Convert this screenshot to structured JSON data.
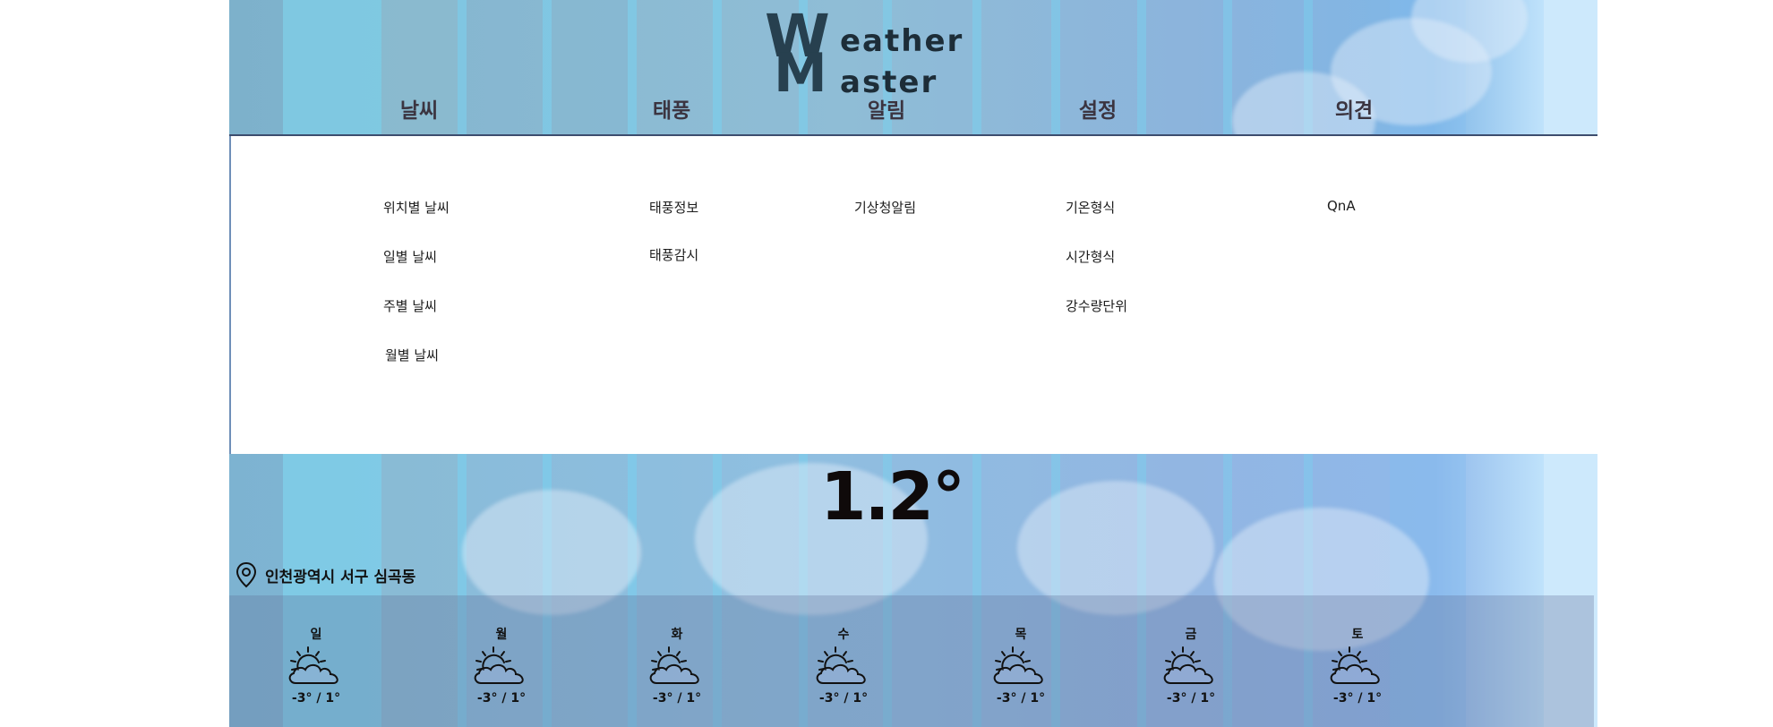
{
  "logo": {
    "line1_big": "W",
    "line1_rest": "eather",
    "line2_big": "M",
    "line2_rest": "aster"
  },
  "nav": [
    {
      "label": "날씨",
      "submenu": [
        "위치별 날씨",
        "일별 날씨",
        "주별 날씨",
        "월별 날씨"
      ]
    },
    {
      "label": "태풍",
      "submenu": [
        "태풍정보",
        "태풍감시"
      ]
    },
    {
      "label": "알림",
      "submenu": [
        "기상청알림"
      ]
    },
    {
      "label": "설정",
      "submenu": [
        "기온형식",
        "시간형식",
        "강수량단위"
      ]
    },
    {
      "label": "의견",
      "submenu": [
        "QnA"
      ]
    }
  ],
  "current": {
    "temperature": "1.2°",
    "location": "인천광역시 서구 심곡동",
    "location_icon": "map-pin-icon"
  },
  "forecast": [
    {
      "day": "일",
      "range": "-3° / 1°",
      "icon": "partly-cloudy-icon"
    },
    {
      "day": "월",
      "range": "-3° / 1°",
      "icon": "partly-cloudy-icon"
    },
    {
      "day": "화",
      "range": "-3° / 1°",
      "icon": "partly-cloudy-icon"
    },
    {
      "day": "수",
      "range": "-3° / 1°",
      "icon": "partly-cloudy-icon"
    },
    {
      "day": "목",
      "range": "-3° / 1°",
      "icon": "partly-cloudy-icon"
    },
    {
      "day": "금",
      "range": "-3° / 1°",
      "icon": "partly-cloudy-icon"
    },
    {
      "day": "토",
      "range": "-3° / 1°",
      "icon": "partly-cloudy-icon"
    }
  ],
  "colors": {
    "nav_text": "#3b3440",
    "logo": "#27404f",
    "header_rule": "#3d4d6e"
  }
}
